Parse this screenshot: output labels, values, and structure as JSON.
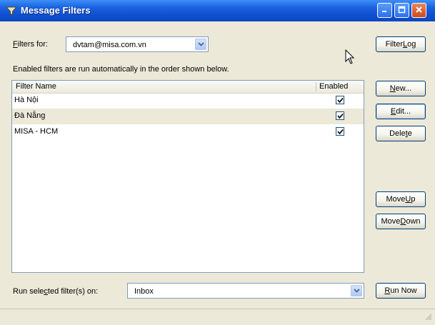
{
  "window": {
    "title": "Message Filters",
    "icons": {
      "app": "filter-funnel-icon",
      "minimize": "minimize-icon",
      "maximize": "maximize-icon",
      "close": "close-icon"
    }
  },
  "filters_for": {
    "label_prefix": "",
    "label_mnemonic": "F",
    "label_rest": "ilters for:",
    "selected": "dvtam@misa.com.vn"
  },
  "info_text": "Enabled filters are run automatically in the order shown below.",
  "table": {
    "columns": [
      "Filter Name",
      "Enabled"
    ],
    "rows": [
      {
        "name": "Hà Nội",
        "enabled": true
      },
      {
        "name": "Đà Nẵng",
        "enabled": true
      },
      {
        "name": "MISA - HCM",
        "enabled": true
      }
    ]
  },
  "buttons": {
    "filter_log": {
      "pre": "Filter ",
      "mn": "L",
      "post": "og"
    },
    "new": {
      "pre": "",
      "mn": "N",
      "post": "ew..."
    },
    "edit": {
      "pre": "",
      "mn": "E",
      "post": "dit..."
    },
    "delete": {
      "pre": "Dele",
      "mn": "t",
      "post": "e"
    },
    "move_up": {
      "pre": "Move ",
      "mn": "U",
      "post": "p"
    },
    "move_down": {
      "pre": "Move ",
      "mn": "D",
      "post": "own"
    },
    "run_now": {
      "pre": "",
      "mn": "R",
      "post": "un Now"
    }
  },
  "run_on": {
    "label_pre": "Run sele",
    "label_mn": "c",
    "label_post": "ted filter(s) on:",
    "selected": "Inbox"
  },
  "colors": {
    "titlebar": "#0b47c3",
    "window_bg": "#ece9d8",
    "selected_row": "#ece9d8",
    "border": "#7f9db9"
  }
}
